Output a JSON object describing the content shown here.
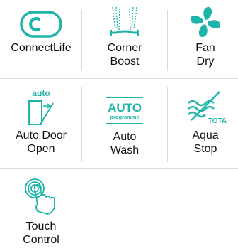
{
  "colors": {
    "accent": "#1fb4a9",
    "text": "#111111",
    "divider": "#d9d9d9"
  },
  "features": [
    {
      "icon": "connectlife-icon",
      "label": "ConnectLife",
      "label_lines": [
        "ConnectLife"
      ]
    },
    {
      "icon": "corner-boost-icon",
      "label": "Corner Boost",
      "label_lines": [
        "Corner",
        "Boost"
      ]
    },
    {
      "icon": "fan-icon",
      "label": "Fan Dry",
      "label_lines": [
        "Fan",
        "Dry"
      ]
    },
    {
      "icon": "auto-door-icon",
      "label": "Auto Door Open",
      "icon_text": "auto",
      "label_lines": [
        "Auto Door",
        "Open"
      ]
    },
    {
      "icon": "auto-wash-icon",
      "label": "Auto Wash",
      "icon_text": "AUTO",
      "icon_subtext": "programme",
      "label_lines": [
        "Auto",
        "Wash"
      ]
    },
    {
      "icon": "aqua-stop-icon",
      "label": "Aqua Stop",
      "icon_text": "TOTAL",
      "label_lines": [
        "Aqua",
        "Stop"
      ]
    },
    {
      "icon": "touch-control-icon",
      "label": "Touch Control",
      "label_lines": [
        "Touch",
        "Control"
      ]
    }
  ]
}
